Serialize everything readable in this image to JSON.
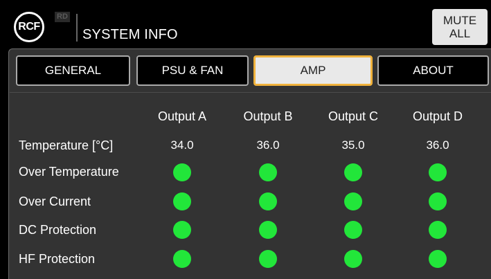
{
  "header": {
    "logo_text": "RCF",
    "badge_text": "RD",
    "title": "SYSTEM INFO",
    "mute_line1": "MUTE",
    "mute_line2": "ALL"
  },
  "tabs": [
    {
      "label": "GENERAL",
      "active": false
    },
    {
      "label": "PSU & FAN",
      "active": false
    },
    {
      "label": "AMP",
      "active": true
    },
    {
      "label": "ABOUT",
      "active": false
    }
  ],
  "colors": {
    "active_tab_border": "#f0b23c",
    "status_ok": "#22e63a",
    "panel_bg": "#333333"
  },
  "amp": {
    "outputs": [
      "Output A",
      "Output B",
      "Output C",
      "Output D"
    ],
    "temperature_label": "Temperature [°C]",
    "temperatures": [
      "34.0",
      "36.0",
      "35.0",
      "36.0"
    ],
    "status_rows": [
      {
        "label": "Over Temperature",
        "states": [
          "ok",
          "ok",
          "ok",
          "ok"
        ]
      },
      {
        "label": "Over Current",
        "states": [
          "ok",
          "ok",
          "ok",
          "ok"
        ]
      },
      {
        "label": "DC Protection",
        "states": [
          "ok",
          "ok",
          "ok",
          "ok"
        ]
      },
      {
        "label": "HF Protection",
        "states": [
          "ok",
          "ok",
          "ok",
          "ok"
        ]
      }
    ]
  }
}
